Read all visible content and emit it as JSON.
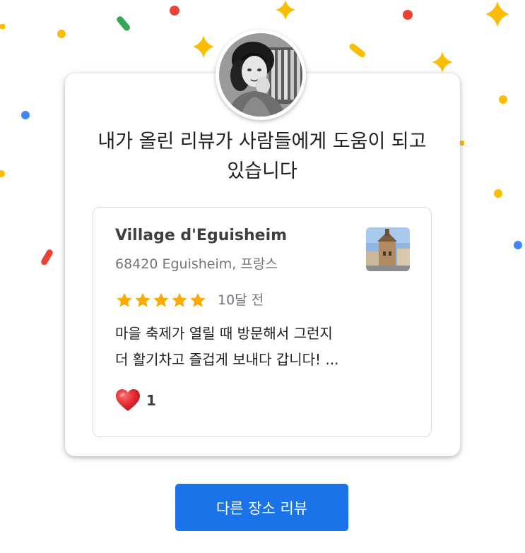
{
  "headline": "내가 올린 리뷰가 사람들에게 도움이 되고 있습니다",
  "profile": {
    "avatar_icon": "user-photo-avatar"
  },
  "review": {
    "place_name": "Village d'Eguisheim",
    "address": "68420 Eguisheim, 프랑스",
    "rating": 5,
    "rating_max": 5,
    "star_color": "#f9ab00",
    "time_ago": "10달 전",
    "text_line1": "마을 축제가 열릴 때 방문해서 그런지",
    "text_line2": "더 활기차고 즐겁게 보내다 갑니다! ...",
    "like_icon": "heart-icon",
    "like_count": "1"
  },
  "button": {
    "label": "다른 장소 리뷰",
    "color": "#1a73e8"
  },
  "confetti_colors": {
    "red": "#ea4335",
    "yellow": "#fbbc04",
    "green": "#34a853",
    "blue": "#4285f4"
  }
}
